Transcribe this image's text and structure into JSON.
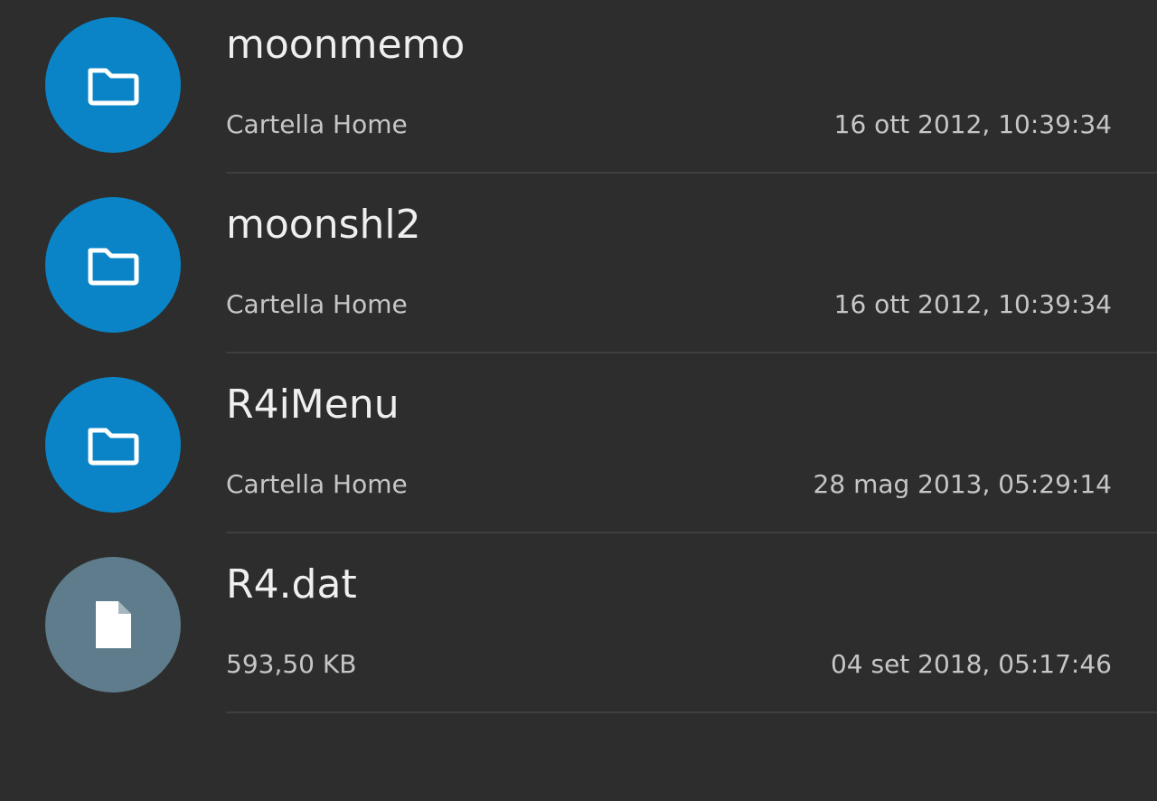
{
  "colors": {
    "background": "#2d2d2d",
    "folder_avatar": "#0a84c6",
    "file_avatar": "#5e7c8b"
  },
  "items": [
    {
      "name": "moonmemo",
      "subtitle": "Cartella Home",
      "date": "16 ott 2012, 10:39:34",
      "icon": "folder-icon",
      "avatar_color": "#0a84c6"
    },
    {
      "name": "moonshl2",
      "subtitle": "Cartella Home",
      "date": "16 ott 2012, 10:39:34",
      "icon": "folder-icon",
      "avatar_color": "#0a84c6"
    },
    {
      "name": "R4iMenu",
      "subtitle": "Cartella Home",
      "date": "28 mag 2013, 05:29:14",
      "icon": "folder-icon",
      "avatar_color": "#0a84c6"
    },
    {
      "name": "R4.dat",
      "subtitle": "593,50 KB",
      "date": "04 set 2018, 05:17:46",
      "icon": "file-icon",
      "avatar_color": "#5e7c8b"
    }
  ]
}
